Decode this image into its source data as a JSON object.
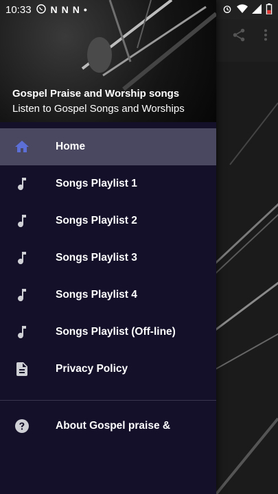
{
  "status_bar": {
    "time": "10:33",
    "notif_n": "N"
  },
  "drawer": {
    "header_title": "Gospel Praise and Worship songs",
    "header_subtitle": "Listen to Gospel Songs and Worships",
    "items": [
      {
        "label": "Home",
        "icon": "home-icon",
        "active": true
      },
      {
        "label": "Songs Playlist 1",
        "icon": "music-note-icon"
      },
      {
        "label": "Songs Playlist 2",
        "icon": "music-note-icon"
      },
      {
        "label": "Songs Playlist 3",
        "icon": "music-note-icon"
      },
      {
        "label": "Songs Playlist 4",
        "icon": "music-note-icon"
      },
      {
        "label": "Songs Playlist (Off-line)",
        "icon": "music-note-icon"
      },
      {
        "label": "Privacy Policy",
        "icon": "document-icon"
      }
    ],
    "footer_items": [
      {
        "label": "About Gospel praise &",
        "icon": "help-icon"
      }
    ]
  },
  "colors": {
    "drawer_bg": "#14102a",
    "active_bg": "#4a4860",
    "home_icon": "#5b6fd6",
    "icon_grey": "#cfcfd6"
  }
}
